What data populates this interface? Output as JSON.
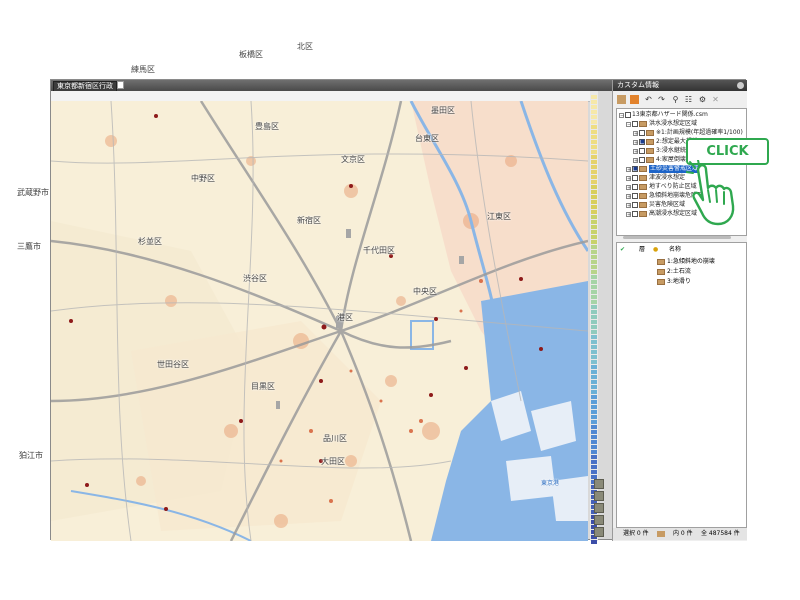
{
  "window": {
    "tab_title": "東京都新宿区行政",
    "doc_icon": "document-icon"
  },
  "map": {
    "labels": [
      {
        "text": "練馬区",
        "key": "nerima"
      },
      {
        "text": "板橋区",
        "key": "itabashi"
      },
      {
        "text": "北区",
        "key": "kita"
      },
      {
        "text": "豊島区",
        "key": "toshima"
      },
      {
        "text": "文京区",
        "key": "bunkyo"
      },
      {
        "text": "台東区",
        "key": "taito"
      },
      {
        "text": "中野区",
        "key": "nakano"
      },
      {
        "text": "新宿区",
        "key": "shinjuku"
      },
      {
        "text": "杉並区",
        "key": "suginami"
      },
      {
        "text": "千代田区",
        "key": "chiyoda"
      },
      {
        "text": "渋谷区",
        "key": "shibuya"
      },
      {
        "text": "中央区",
        "key": "chuo"
      },
      {
        "text": "港区",
        "key": "minato"
      },
      {
        "text": "世田谷区",
        "key": "setagaya"
      },
      {
        "text": "目黒区",
        "key": "meguro"
      },
      {
        "text": "品川区",
        "key": "shinagawa"
      },
      {
        "text": "大田区",
        "key": "ota"
      },
      {
        "text": "武蔵野市",
        "key": "musashino"
      },
      {
        "text": "三鷹市",
        "key": "mitaka"
      },
      {
        "text": "狛江市",
        "key": "komae"
      },
      {
        "text": "墨田区",
        "key": "sumida"
      },
      {
        "text": "江東区",
        "key": "koto"
      },
      {
        "text": "東京港",
        "key": "tokyoko"
      }
    ]
  },
  "panel": {
    "title": "カスタム情報",
    "toolbar_icons": [
      "folder-icon",
      "layers-icon",
      "undo-icon",
      "redo-icon",
      "search-icon",
      "tree-icon",
      "settings-icon",
      "grid-icon"
    ],
    "tree": {
      "root": "13東京都ハザード関係.csm",
      "items": [
        {
          "label": "洪水浸水想定区域",
          "indent": 1,
          "exp": "−",
          "checked": false
        },
        {
          "label": "※1:計画規模(年超過確率1/100)",
          "indent": 2,
          "exp": "+",
          "checked": false
        },
        {
          "label": "2:想定最大規模",
          "indent": 2,
          "exp": "+",
          "checked": true
        },
        {
          "label": "3:浸水継続時間",
          "indent": 2,
          "exp": "+",
          "checked": false
        },
        {
          "label": "4:家屋倒壊等氾濫想定区域",
          "indent": 2,
          "exp": "+",
          "checked": false
        },
        {
          "label": "土砂災害警戒区域",
          "indent": 1,
          "exp": "+",
          "checked": true,
          "selected": true
        },
        {
          "label": "津波浸水想定",
          "indent": 1,
          "exp": "+",
          "checked": false
        },
        {
          "label": "地すべり防止区域",
          "indent": 1,
          "exp": "+",
          "checked": false
        },
        {
          "label": "急傾斜地崩壊危険区域",
          "indent": 1,
          "exp": "+",
          "checked": false
        },
        {
          "label": "災害危険区域",
          "indent": 1,
          "exp": "+",
          "checked": false
        },
        {
          "label": "高潮浸水想定区域",
          "indent": 1,
          "exp": "+",
          "checked": false
        }
      ]
    },
    "attributes": {
      "col_layer": "層",
      "col_name": "名称",
      "rows": [
        "1:急傾斜地の崩壊",
        "2:土石流",
        "3:地滑り"
      ]
    },
    "status": {
      "selected": "選択 0 件",
      "inside": "内 0 件",
      "total": "全 487584 件"
    }
  },
  "callout": {
    "label": "CLICK"
  },
  "colors": {
    "map_bg": "#f6f1e6",
    "water": "#8ab6e6",
    "selection": "#1d64c8",
    "callout": "#2fa84f"
  }
}
